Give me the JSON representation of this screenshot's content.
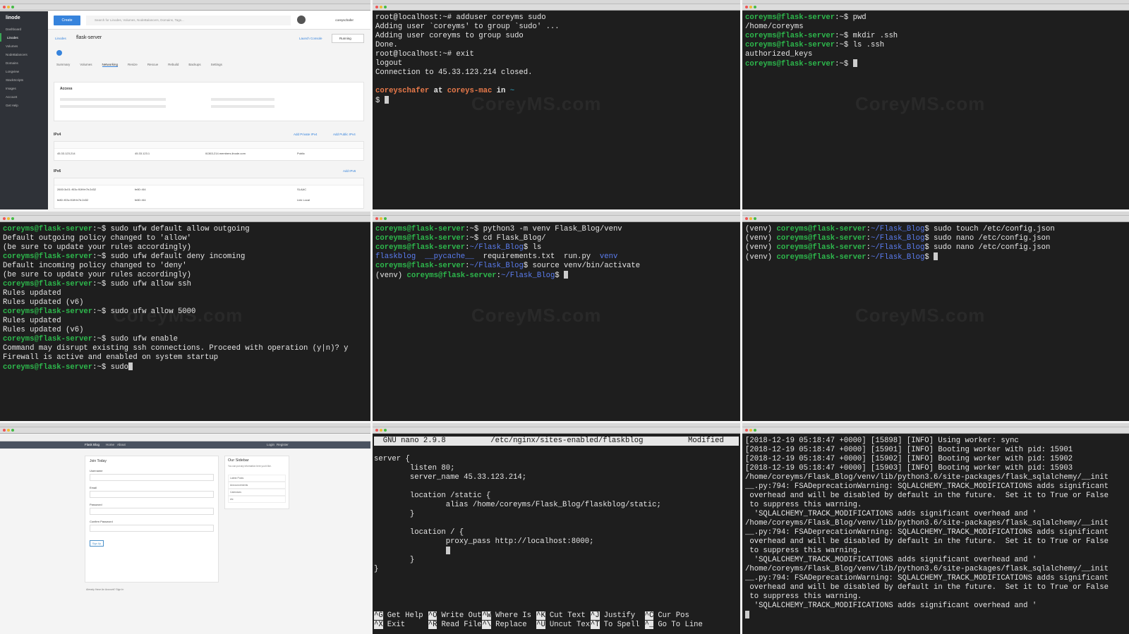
{
  "watermark": "CoreyMS.com",
  "linode": {
    "logo": "linode",
    "nav": [
      "Dashboard",
      "Linodes",
      "Volumes",
      "NodeBalancers",
      "Domains",
      "Longview",
      "StackScripts",
      "Images",
      "Account",
      "Get Help"
    ],
    "create_label": "Create",
    "search_placeholder": "Search for Linodes, Volumes, NodeBalancers, Domains, Tags...",
    "username": "coreyschafer",
    "breadcrumb_root": "Linodes",
    "server_name": "flask-server",
    "launch_console": "Launch Console",
    "status": "Running",
    "tabs": [
      "Summary",
      "Volumes",
      "Networking",
      "Resize",
      "Rescue",
      "Rebuild",
      "Backups",
      "Settings"
    ],
    "access_title": "Access",
    "ipv4_title": "IPv4",
    "ipv6_title": "IPv6",
    "add_private": "Add Private IPv4",
    "add_public": "Add Public IPv4",
    "add_ipv6": "Add IPv6",
    "ipv4_row": [
      "45.33.123.214",
      "45.33.123.1",
      "li1363-214.members.linode.com",
      "Public"
    ],
    "ipv6_rows": [
      [
        "2600:3c01::f03c:91ff:fe7b:2d32",
        "fe80::/64",
        "",
        "SLAAC"
      ],
      [
        "fe80::f03c:91ff:fe7b:2d32",
        "fe80::/64",
        "",
        "Link Local"
      ]
    ]
  },
  "t2": {
    "lines": [
      [
        [
          "root@localhost:~# adduser coreyms sudo",
          ""
        ]
      ],
      [
        [
          "Adding user `coreyms' to group `sudo' ...",
          ""
        ]
      ],
      [
        [
          "Adding user coreyms to group sudo",
          ""
        ]
      ],
      [
        [
          "Done.",
          ""
        ]
      ],
      [
        [
          "root@localhost:~# exit",
          ""
        ]
      ],
      [
        [
          "logout",
          ""
        ]
      ],
      [
        [
          "Connection to 45.33.123.214 closed.",
          ""
        ]
      ],
      [
        [
          "",
          ""
        ]
      ],
      [
        [
          "coreyschafer",
          "orange"
        ],
        [
          " at ",
          "bold"
        ],
        [
          "coreys-mac",
          "orange"
        ],
        [
          " in ",
          "bold"
        ],
        [
          "~",
          "teal"
        ]
      ],
      [
        [
          "$ ",
          ""
        ]
      ]
    ]
  },
  "t3": {
    "lines": [
      [
        [
          "coreyms@flask-server",
          "green"
        ],
        [
          ":~$ pwd",
          ""
        ]
      ],
      [
        [
          "/home/coreyms",
          ""
        ]
      ],
      [
        [
          "coreyms@flask-server",
          "green"
        ],
        [
          ":~$ mkdir .ssh",
          ""
        ]
      ],
      [
        [
          "coreyms@flask-server",
          "green"
        ],
        [
          ":~$ ls .ssh",
          ""
        ]
      ],
      [
        [
          "authorized_keys",
          ""
        ]
      ],
      [
        [
          "coreyms@flask-server",
          "green"
        ],
        [
          ":~$ ",
          ""
        ]
      ]
    ]
  },
  "t4": {
    "lines": [
      [
        [
          "coreyms@flask-server",
          "green"
        ],
        [
          ":~$ sudo ufw default allow outgoing",
          ""
        ]
      ],
      [
        [
          "Default outgoing policy changed to 'allow'",
          ""
        ]
      ],
      [
        [
          "(be sure to update your rules accordingly)",
          ""
        ]
      ],
      [
        [
          "coreyms@flask-server",
          "green"
        ],
        [
          ":~$ sudo ufw default deny incoming",
          ""
        ]
      ],
      [
        [
          "Default incoming policy changed to 'deny'",
          ""
        ]
      ],
      [
        [
          "(be sure to update your rules accordingly)",
          ""
        ]
      ],
      [
        [
          "coreyms@flask-server",
          "green"
        ],
        [
          ":~$ sudo ufw allow ssh",
          ""
        ]
      ],
      [
        [
          "Rules updated",
          ""
        ]
      ],
      [
        [
          "Rules updated (v6)",
          ""
        ]
      ],
      [
        [
          "coreyms@flask-server",
          "green"
        ],
        [
          ":~$ sudo ufw allow 5000",
          ""
        ]
      ],
      [
        [
          "Rules updated",
          ""
        ]
      ],
      [
        [
          "Rules updated (v6)",
          ""
        ]
      ],
      [
        [
          "coreyms@flask-server",
          "green"
        ],
        [
          ":~$ sudo ufw enable",
          ""
        ]
      ],
      [
        [
          "Command may disrupt existing ssh connections. Proceed with operation (y|n)? y",
          ""
        ]
      ],
      [
        [
          "Firewall is active and enabled on system startup",
          ""
        ]
      ],
      [
        [
          "coreyms@flask-server",
          "green"
        ],
        [
          ":~$ sudo",
          ""
        ]
      ]
    ]
  },
  "t5": {
    "lines": [
      [
        [
          "coreyms@flask-server",
          "green"
        ],
        [
          ":~$ python3 -m venv Flask_Blog/venv",
          ""
        ]
      ],
      [
        [
          "coreyms@flask-server",
          "green"
        ],
        [
          ":~$ cd Flask_Blog/",
          ""
        ]
      ],
      [
        [
          "coreyms@flask-server",
          "green"
        ],
        [
          ":",
          ""
        ],
        [
          "~/Flask_Blog",
          "blue"
        ],
        [
          "$ ls",
          ""
        ]
      ],
      [
        [
          "flaskblog",
          "blue"
        ],
        [
          "  ",
          ""
        ],
        [
          "__pycache__",
          "blue"
        ],
        [
          "  requirements.txt  run.py  ",
          ""
        ],
        [
          "venv",
          "blue"
        ]
      ],
      [
        [
          "coreyms@flask-server",
          "green"
        ],
        [
          ":",
          ""
        ],
        [
          "~/Flask_Blog",
          "blue"
        ],
        [
          "$ source venv/bin/activate",
          ""
        ]
      ],
      [
        [
          "(venv) ",
          ""
        ],
        [
          "coreyms@flask-server",
          "green"
        ],
        [
          ":",
          ""
        ],
        [
          "~/Flask_Blog",
          "blue"
        ],
        [
          "$ ",
          ""
        ]
      ]
    ]
  },
  "t6": {
    "lines": [
      [
        [
          "(venv) ",
          ""
        ],
        [
          "coreyms@flask-server",
          "green"
        ],
        [
          ":",
          ""
        ],
        [
          "~/Flask_Blog",
          "blue"
        ],
        [
          "$ sudo touch /etc/config.json",
          ""
        ]
      ],
      [
        [
          "(venv) ",
          ""
        ],
        [
          "coreyms@flask-server",
          "green"
        ],
        [
          ":",
          ""
        ],
        [
          "~/Flask_Blog",
          "blue"
        ],
        [
          "$ sudo nano /etc/config.json",
          ""
        ]
      ],
      [
        [
          "(venv) ",
          ""
        ],
        [
          "coreyms@flask-server",
          "green"
        ],
        [
          ":",
          ""
        ],
        [
          "~/Flask_Blog",
          "blue"
        ],
        [
          "$ sudo nano /etc/config.json",
          ""
        ]
      ],
      [
        [
          "(venv) ",
          ""
        ],
        [
          "coreyms@flask-server",
          "green"
        ],
        [
          ":",
          ""
        ],
        [
          "~/Flask_Blog",
          "blue"
        ],
        [
          "$ ",
          ""
        ]
      ]
    ]
  },
  "blog": {
    "brand": "Flask Blog",
    "nav": [
      "Home",
      "About"
    ],
    "nav_right": [
      "Login",
      "Register"
    ],
    "form_title": "Join Today",
    "fields": [
      "Username",
      "Email",
      "Password",
      "Confirm Password"
    ],
    "submit": "Sign Up",
    "already": "Already Have An Account? Sign In",
    "sidebar_title": "Our Sidebar",
    "sidebar_text": "You can put any information here you'd like.",
    "sidebar_items": [
      "Latest Posts",
      "Announcements",
      "Calendars",
      "etc"
    ]
  },
  "nano": {
    "header": "  GNU nano 2.9.8          /etc/nginx/sites-enabled/flaskblog          Modified  ",
    "lines": [
      "server {",
      "        listen 80;",
      "        server_name 45.33.123.214;",
      "",
      "        location /static {",
      "                alias /home/coreyms/Flask_Blog/flaskblog/static;",
      "        }",
      "",
      "        location / {",
      "                proxy_pass http://localhost:8000;",
      "",
      "        }",
      "}"
    ],
    "shortcuts_row1": [
      [
        "^G",
        "Get Help"
      ],
      [
        "^O",
        "Write Out"
      ],
      [
        "^W",
        "Where Is"
      ],
      [
        "^K",
        "Cut Text"
      ],
      [
        "^J",
        "Justify"
      ],
      [
        "^C",
        "Cur Pos"
      ]
    ],
    "shortcuts_row2": [
      [
        "^X",
        "Exit"
      ],
      [
        "^R",
        "Read File"
      ],
      [
        "^\\",
        "Replace"
      ],
      [
        "^U",
        "Uncut Text"
      ],
      [
        "^T",
        "To Spell"
      ],
      [
        "^_",
        "Go To Line"
      ]
    ]
  },
  "t9": {
    "lines": [
      "[2018-12-19 05:18:47 +0000] [15898] [INFO] Using worker: sync",
      "[2018-12-19 05:18:47 +0000] [15901] [INFO] Booting worker with pid: 15901",
      "[2018-12-19 05:18:47 +0000] [15902] [INFO] Booting worker with pid: 15902",
      "[2018-12-19 05:18:47 +0000] [15903] [INFO] Booting worker with pid: 15903",
      "/home/coreyms/Flask_Blog/venv/lib/python3.6/site-packages/flask_sqlalchemy/__init",
      "__.py:794: FSADeprecationWarning: SQLALCHEMY_TRACK_MODIFICATIONS adds significant",
      " overhead and will be disabled by default in the future.  Set it to True or False",
      " to suppress this warning.",
      "  'SQLALCHEMY_TRACK_MODIFICATIONS adds significant overhead and '",
      "/home/coreyms/Flask_Blog/venv/lib/python3.6/site-packages/flask_sqlalchemy/__init",
      "__.py:794: FSADeprecationWarning: SQLALCHEMY_TRACK_MODIFICATIONS adds significant",
      " overhead and will be disabled by default in the future.  Set it to True or False",
      " to suppress this warning.",
      "  'SQLALCHEMY_TRACK_MODIFICATIONS adds significant overhead and '",
      "/home/coreyms/Flask_Blog/venv/lib/python3.6/site-packages/flask_sqlalchemy/__init",
      "__.py:794: FSADeprecationWarning: SQLALCHEMY_TRACK_MODIFICATIONS adds significant",
      " overhead and will be disabled by default in the future.  Set it to True or False",
      " to suppress this warning.",
      "  'SQLALCHEMY_TRACK_MODIFICATIONS adds significant overhead and '"
    ]
  }
}
